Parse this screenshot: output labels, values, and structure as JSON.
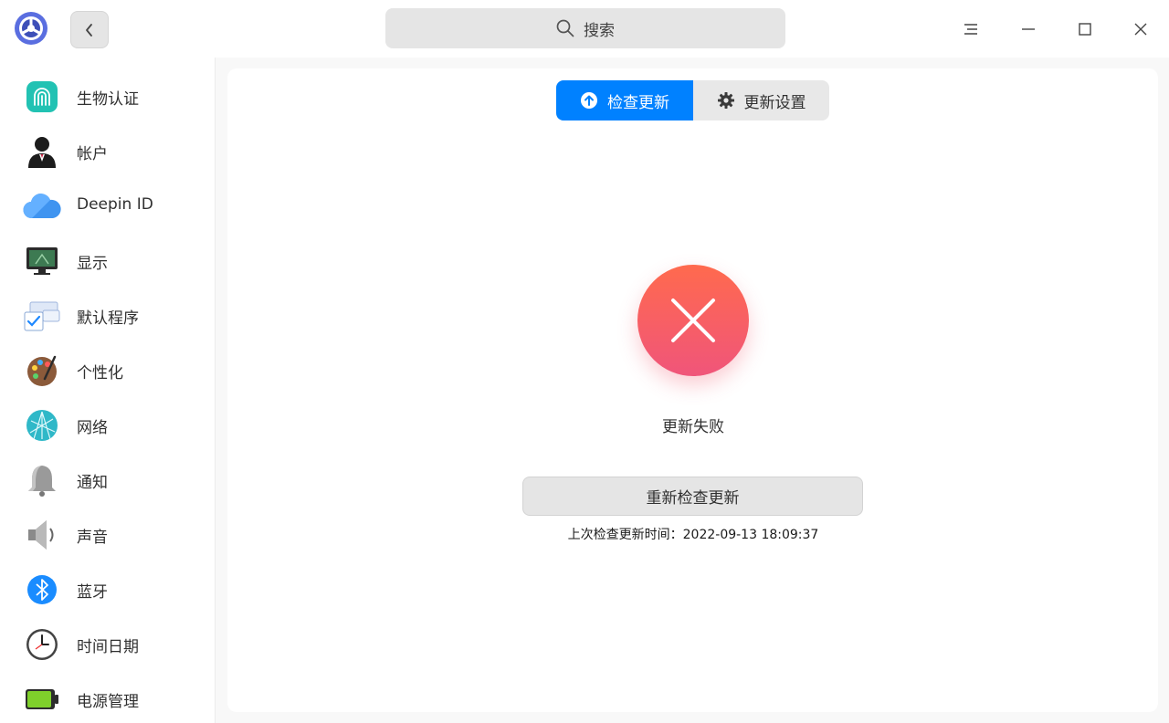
{
  "titlebar": {
    "search_placeholder": "搜索",
    "icons": [
      "app-logo-icon",
      "back-arrow-icon",
      "search-icon",
      "menu-icon",
      "minimize-icon",
      "maximize-icon",
      "close-icon"
    ]
  },
  "sidebar": {
    "items": [
      {
        "label": "生物认证",
        "icon": "fingerprint-icon"
      },
      {
        "label": "帐户",
        "icon": "account-icon"
      },
      {
        "label": "Deepin ID",
        "icon": "cloud-icon"
      },
      {
        "label": "显示",
        "icon": "monitor-icon"
      },
      {
        "label": "默认程序",
        "icon": "default-apps-icon"
      },
      {
        "label": "个性化",
        "icon": "palette-icon"
      },
      {
        "label": "网络",
        "icon": "network-icon"
      },
      {
        "label": "通知",
        "icon": "bell-icon"
      },
      {
        "label": "声音",
        "icon": "speaker-icon"
      },
      {
        "label": "蓝牙",
        "icon": "bluetooth-icon"
      },
      {
        "label": "时间日期",
        "icon": "clock-icon"
      },
      {
        "label": "电源管理",
        "icon": "battery-icon"
      }
    ]
  },
  "main": {
    "tabs": [
      {
        "label": "检查更新",
        "icon": "upload-circle-icon",
        "active": true
      },
      {
        "label": "更新设置",
        "icon": "gear-icon",
        "active": false
      }
    ],
    "status_text": "更新失败",
    "retry_label": "重新检查更新",
    "last_check": "上次检查更新时间：2022-09-13 18:09:37"
  },
  "colors": {
    "accent": "#0081ff",
    "error_top": "#ff6a4e",
    "error_bottom": "#f0557a"
  }
}
